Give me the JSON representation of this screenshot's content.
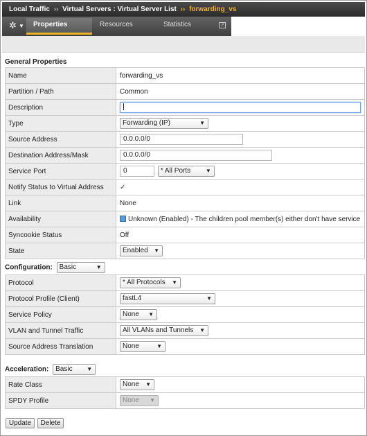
{
  "breadcrumb": {
    "item1": "Local Traffic",
    "sep": "››",
    "item2": "Virtual Servers : Virtual Server List",
    "current": "forwarding_vs"
  },
  "tabs": [
    {
      "label": "Properties",
      "active": true
    },
    {
      "label": "Resources",
      "active": false
    },
    {
      "label": "Statistics",
      "active": false
    }
  ],
  "icons": {
    "settings": "gear-icon",
    "menu_caret": "chevron-down-icon",
    "popout": "popout-icon",
    "availability": "status-square-blue-icon"
  },
  "colors": {
    "accent": "#f0b428",
    "titlebar": "#3a3a3a",
    "focus_border": "#6e9ee8",
    "availability": "#5a9ad6"
  },
  "general": {
    "heading": "General Properties",
    "name": {
      "label": "Name",
      "value": "forwarding_vs"
    },
    "partition": {
      "label": "Partition / Path",
      "value": "Common"
    },
    "description": {
      "label": "Description",
      "value": ""
    },
    "type": {
      "label": "Type",
      "value": "Forwarding (IP)"
    },
    "source": {
      "label": "Source Address",
      "value": "0.0.0.0/0"
    },
    "destination": {
      "label": "Destination Address/Mask",
      "value": "0.0.0.0/0"
    },
    "service_port": {
      "label": "Service Port",
      "value": "0",
      "select": "* All Ports"
    },
    "notify": {
      "label": "Notify Status to Virtual Address",
      "checked": true
    },
    "link": {
      "label": "Link",
      "value": "None"
    },
    "availability": {
      "label": "Availability",
      "value": "Unknown (Enabled) - The children pool member(s) either don't have service"
    },
    "syncookie": {
      "label": "Syncookie Status",
      "value": "Off"
    },
    "state": {
      "label": "State",
      "value": "Enabled"
    }
  },
  "configuration": {
    "heading": "Configuration:",
    "mode": "Basic",
    "protocol": {
      "label": "Protocol",
      "value": "* All Protocols"
    },
    "protocol_profile": {
      "label": "Protocol Profile (Client)",
      "value": "fastL4"
    },
    "service_policy": {
      "label": "Service Policy",
      "value": "None"
    },
    "vlan": {
      "label": "VLAN and Tunnel Traffic",
      "value": "All VLANs and Tunnels"
    },
    "snat": {
      "label": "Source Address Translation",
      "value": "None"
    }
  },
  "acceleration": {
    "heading": "Acceleration:",
    "mode": "Basic",
    "rate_class": {
      "label": "Rate Class",
      "value": "None"
    },
    "spdy": {
      "label": "SPDY Profile",
      "value": "None"
    }
  },
  "buttons": {
    "update": "Update",
    "delete": "Delete"
  }
}
